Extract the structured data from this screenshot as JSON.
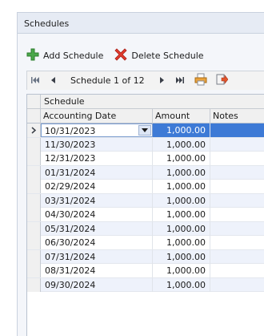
{
  "panel": {
    "title": "Schedules"
  },
  "toolbar": {
    "add_label": "Add Schedule",
    "delete_label": "Delete Schedule"
  },
  "navigator": {
    "position_text": "Schedule 1 of 12"
  },
  "grid": {
    "caption": "Schedule",
    "columns": [
      "Accounting Date",
      "Amount",
      "Notes"
    ],
    "rows": [
      {
        "date": "10/31/2023",
        "amount": "1,000.00",
        "notes": ""
      },
      {
        "date": "11/30/2023",
        "amount": "1,000.00",
        "notes": ""
      },
      {
        "date": "12/31/2023",
        "amount": "1,000.00",
        "notes": ""
      },
      {
        "date": "01/31/2024",
        "amount": "1,000.00",
        "notes": ""
      },
      {
        "date": "02/29/2024",
        "amount": "1,000.00",
        "notes": ""
      },
      {
        "date": "03/31/2024",
        "amount": "1,000.00",
        "notes": ""
      },
      {
        "date": "04/30/2024",
        "amount": "1,000.00",
        "notes": ""
      },
      {
        "date": "05/31/2024",
        "amount": "1,000.00",
        "notes": ""
      },
      {
        "date": "06/30/2024",
        "amount": "1,000.00",
        "notes": ""
      },
      {
        "date": "07/31/2024",
        "amount": "1,000.00",
        "notes": ""
      },
      {
        "date": "08/31/2024",
        "amount": "1,000.00",
        "notes": ""
      },
      {
        "date": "09/30/2024",
        "amount": "1,000.00",
        "notes": ""
      }
    ]
  },
  "colors": {
    "selection": "#3d7ad6",
    "alt_row": "#eef2fb",
    "header_bg": "#e6ebf4"
  },
  "icons": {
    "add": "green-plus-icon",
    "delete": "red-x-icon",
    "first": "first-record-icon",
    "prev": "prev-record-icon",
    "next": "next-record-icon",
    "last": "last-record-icon",
    "print": "print-icon",
    "export": "export-icon"
  }
}
